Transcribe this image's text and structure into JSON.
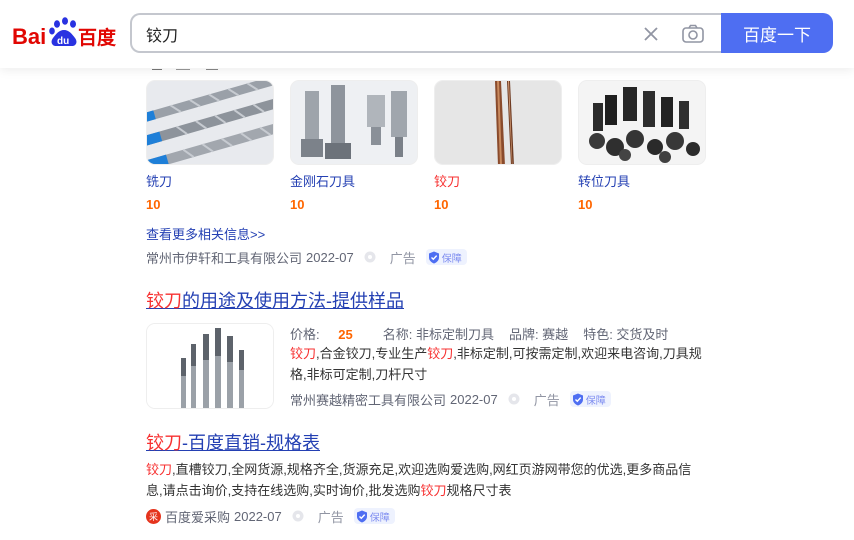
{
  "header": {
    "logo_alt": "Baidu 百度",
    "search_value": "铰刀",
    "search_button": "百度一下"
  },
  "products": [
    {
      "name": "铣刀",
      "price": "10"
    },
    {
      "name": "金刚石刀具",
      "price": "10"
    },
    {
      "name": "铰刀",
      "price": "10"
    },
    {
      "name": "转位刀具",
      "price": "10"
    }
  ],
  "more_link": "查看更多相关信息>>",
  "ad_block_source": {
    "company": "常州市伊轩和工具有限公司",
    "date": "2022-07",
    "ad": "广告",
    "badge": "保障"
  },
  "result1": {
    "title_hl": "铰刀",
    "title_rest": "的用途及使用方法-提供样品",
    "price_label": "价格:",
    "price_value": "25",
    "attrs": [
      "名称: 非标定制刀具",
      "品牌: 赛越",
      "特色: 交货及时"
    ],
    "desc": [
      {
        "t": "铰刀",
        "hl": true
      },
      {
        "t": ",合金铰刀,专业生产",
        "hl": false
      },
      {
        "t": "铰刀",
        "hl": true
      },
      {
        "t": ",非标定制,可按需定制,欢迎来电咨询,刀具规格,非标可定制,刀杆尺寸",
        "hl": false
      }
    ],
    "source": {
      "company": "常州赛越精密工具有限公司",
      "date": "2022-07",
      "ad": "广告",
      "badge": "保障"
    }
  },
  "result2": {
    "title_hl": "铰刀",
    "title_rest": "-百度直销-规格表",
    "desc": [
      {
        "t": "铰刀",
        "hl": true
      },
      {
        "t": ",直槽铰刀,全网货源,规格齐全,货源充足,欢迎选购爱选购,网红页游网带您的优选,更多商品信息,请点击询价,支持在线选购,实时询价,批发选购",
        "hl": false
      },
      {
        "t": "铰刀",
        "hl": true
      },
      {
        "t": "规格尺寸表",
        "hl": false
      }
    ],
    "source": {
      "icon_text": "采",
      "company": "百度爱采购",
      "date": "2022-07",
      "ad": "广告",
      "badge": "保障"
    }
  }
}
